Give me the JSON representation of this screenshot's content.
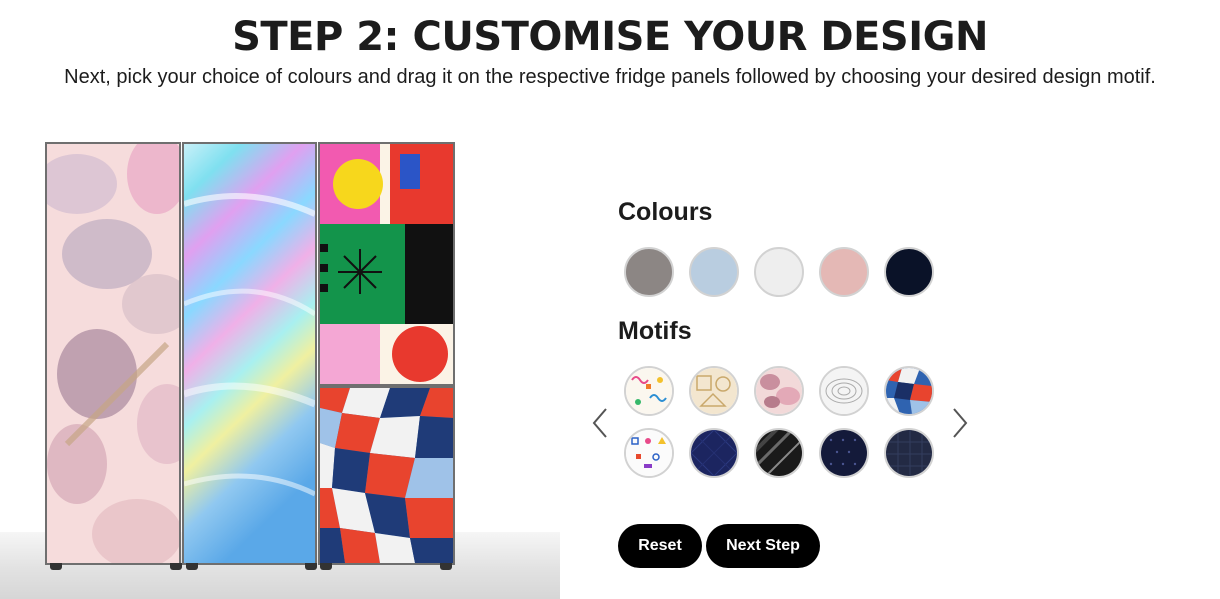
{
  "header": {
    "title": "STEP 2: CUSTOMISE YOUR DESIGN",
    "subtitle": "Next, pick your choice of colours and drag it on the respective fridge panels followed by choosing your desired design motif."
  },
  "fridge": {
    "panels": [
      {
        "name": "left-door",
        "motif": "watercolour-floral"
      },
      {
        "name": "middle-door",
        "motif": "holographic"
      },
      {
        "name": "right-top-door",
        "motif": "geometric-abstract"
      },
      {
        "name": "right-bottom-drawer",
        "motif": "mosaic"
      }
    ]
  },
  "colours": {
    "label": "Colours",
    "items": [
      {
        "name": "grey",
        "color": "#8c8684"
      },
      {
        "name": "light-blue",
        "color": "#b9cde0"
      },
      {
        "name": "white",
        "color": "#eeeeee"
      },
      {
        "name": "pink",
        "color": "#e4b8b5"
      },
      {
        "name": "navy",
        "color": "#0a1228"
      }
    ]
  },
  "motifs": {
    "label": "Motifs",
    "items": [
      {
        "name": "confetti-squiggles"
      },
      {
        "name": "beige-geometric"
      },
      {
        "name": "pink-watercolour"
      },
      {
        "name": "topographic-lines"
      },
      {
        "name": "blue-red-mosaic"
      },
      {
        "name": "letters-shapes"
      },
      {
        "name": "navy-diamond"
      },
      {
        "name": "black-gloss-stripes"
      },
      {
        "name": "navy-dots"
      },
      {
        "name": "navy-lattice"
      }
    ],
    "prev_icon": "chevron-left-icon",
    "next_icon": "chevron-right-icon"
  },
  "actions": {
    "reset_label": "Reset",
    "next_label": "Next Step"
  }
}
